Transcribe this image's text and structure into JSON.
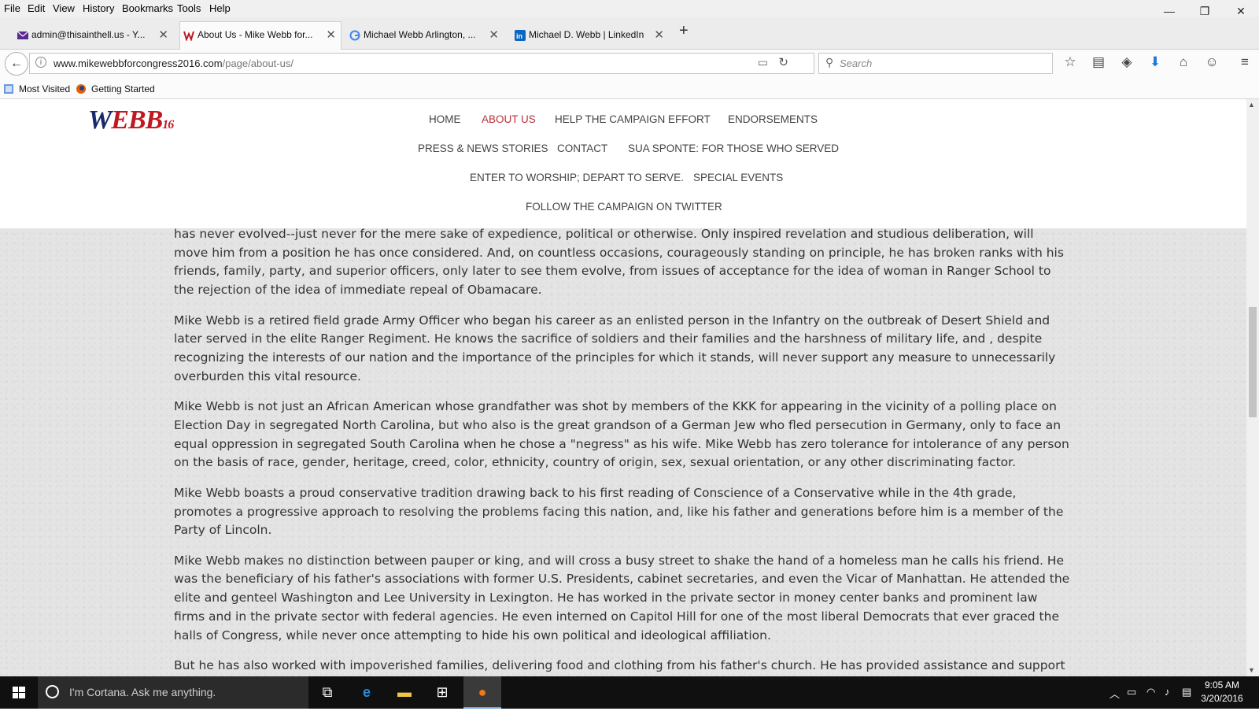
{
  "menubar": {
    "items": [
      "File",
      "Edit",
      "View",
      "History",
      "Bookmarks",
      "Tools",
      "Help"
    ]
  },
  "window_controls": {
    "minimize": "—",
    "restore": "❐",
    "close": "✕"
  },
  "tabs": [
    {
      "title": "admin@thisainthell.us - Y...",
      "icon": "mail-icon",
      "active": false
    },
    {
      "title": "About Us - Mike Webb for...",
      "icon": "webb-logo-icon",
      "active": true
    },
    {
      "title": "Michael Webb Arlington, ...",
      "icon": "google-icon",
      "active": false
    },
    {
      "title": "Michael D. Webb | LinkedIn",
      "icon": "linkedin-icon",
      "active": false
    }
  ],
  "new_tab": "+",
  "urlbar": {
    "domain": "www.mikewebbforcongress2016.com",
    "path": "/page/about-us/"
  },
  "searchbar": {
    "placeholder": "Search"
  },
  "bookmarks": {
    "most_visited": "Most Visited",
    "getting_started": "Getting Started"
  },
  "site": {
    "logo": {
      "w": "W",
      "ebb": "EBB",
      "year": "16"
    },
    "nav": [
      "HOME",
      "ABOUT US",
      "HELP THE CAMPAIGN EFFORT",
      "ENDORSEMENTS",
      "PRESS & NEWS STORIES",
      "CONTACT",
      "SUA SPONTE: FOR THOSE WHO SERVED",
      "ENTER TO WORSHIP; DEPART TO SERVE.",
      "SPECIAL EVENTS",
      "FOLLOW THE CAMPAIGN ON TWITTER"
    ],
    "current_nav": "ABOUT US"
  },
  "article": {
    "paragraphs": [
      "has never evolved--just never for the mere sake of expedience, political or otherwise.  Only inspired revelation and studious deliberation, will move him from a position he has once considered.   And, on countless occasions, courageously standing on principle, he has broken ranks with his friends, family, party, and superior officers, only later to see them evolve, from issues of acceptance for the idea of woman in Ranger School to the rejection of the idea of immediate repeal of Obamacare.",
      "Mike Webb is a retired field grade Army Officer who began his career as an enlisted person in the Infantry on the outbreak of Desert Shield and later served in the elite Ranger Regiment.  He knows the sacrifice of soldiers and their families and the harshness of military life, and , despite recognizing the interests of our nation and the importance of the principles for which it stands, will never support any measure to unnecessarily overburden this vital resource.",
      "Mike Webb is not just an African American whose grandfather was shot by members of the KKK for appearing in the vicinity of a polling place on Election Day in segregated North Carolina, but who also is the great grandson of a German Jew who fled persecution in Germany, only to face an equal oppression in segregated South Carolina when he chose a \"negress\" as his wife.  Mike Webb has zero tolerance for intolerance of any person on the basis of race, gender, heritage, creed, color, ethnicity, country of origin, sex, sexual orientation, or any other discriminating factor.",
      "Mike Webb boasts a proud conservative tradition drawing back to his first reading of Conscience of a Conservative while in the 4th grade, promotes a progressive approach to resolving the problems facing this nation, and, like his father and generations before him is a member of the Party of Lincoln.",
      "Mike Webb makes no distinction between pauper or king, and will cross a busy street to shake the hand of a homeless man he calls his friend.  He was the beneficiary of his father's associations with former U.S. Presidents, cabinet secretaries, and even the Vicar of Manhattan.  He attended the elite and genteel Washington and Lee University in Lexington.  He has worked in the private sector in money center banks and prominent law firms and in the private sector with federal agencies.  He even interned on Capitol Hill for one of the most liberal Democrats that ever graced the halls of Congress, while never once attempting to hide his own political and ideological affiliation.",
      "But he has also worked with impoverished families, delivering food and clothing from his father's church.  He has provided assistance and support to homeless veterans through his board memberships and volunteer activities.  He has advocated diversity and challenge issues as a soon to be"
    ]
  },
  "taskbar": {
    "cortana_placeholder": "I'm Cortana. Ask me anything.",
    "clock_time": "9:05 AM",
    "clock_date": "3/20/2016"
  },
  "colors": {
    "nav_active": "#b8323a",
    "taskbar": "#101010",
    "logo_red": "#c01820",
    "logo_blue": "#1a2b6a"
  }
}
